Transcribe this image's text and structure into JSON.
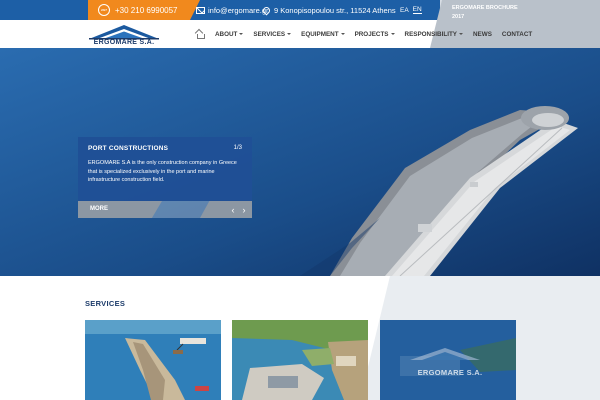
{
  "topbar": {
    "phone_icon_text": "24/7",
    "phone": "+30 210 6990057",
    "email": "info@ergomare.gr",
    "address": "9 Konopisopoulou str., 11524 Athens",
    "languages": [
      "EA",
      "EN"
    ],
    "active_language": "EN",
    "brochure_label": "ERGOMARE BROCHURE",
    "brochure_year": "2017"
  },
  "header": {
    "logo_text": "ERGOMARE S.A.",
    "nav": [
      {
        "label": "ABOUT",
        "dropdown": true
      },
      {
        "label": "SERVICES",
        "dropdown": true
      },
      {
        "label": "EQUIPMENT",
        "dropdown": true
      },
      {
        "label": "PROJECTS",
        "dropdown": true
      },
      {
        "label": "RESPONSIBILITY",
        "dropdown": true
      },
      {
        "label": "NEWS",
        "dropdown": false
      },
      {
        "label": "CONTACT",
        "dropdown": false
      }
    ]
  },
  "hero": {
    "slide_title": "PORT CONSTRUCTIONS",
    "slide_counter": "1/3",
    "slide_description": "ERGOMARE S.A is the only construction company in Greece that is specialized exclusively in the port and marine infrastructure construction field.",
    "more_label": "MORE",
    "prev_symbol": "‹",
    "next_symbol": "›"
  },
  "services": {
    "title": "SERVICES",
    "card_logo_text": "ERGOMARE S.A."
  },
  "colors": {
    "top_blue": "#1d5fa6",
    "phone_orange": "#f1891d",
    "brand_navy": "#1c3b6a",
    "slide_blue": "#204f96"
  }
}
